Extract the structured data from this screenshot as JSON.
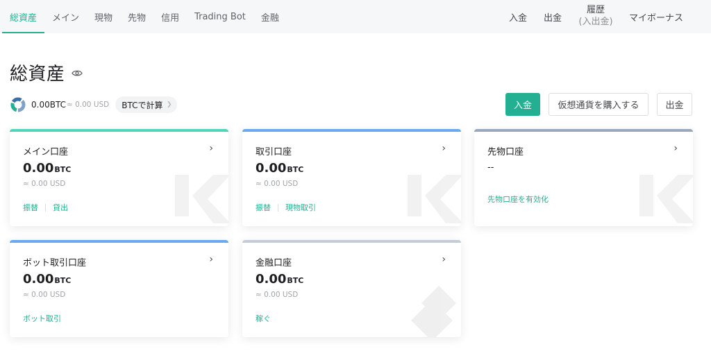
{
  "nav": {
    "left_items": [
      {
        "label": "総資産",
        "active": true
      },
      {
        "label": "メイン"
      },
      {
        "label": "現物"
      },
      {
        "label": "先物"
      },
      {
        "label": "信用"
      },
      {
        "label": "Trading Bot"
      },
      {
        "label": "金融"
      }
    ],
    "deposit": "入金",
    "withdraw": "出金",
    "history": "履歴",
    "history_sub": "(入出金)",
    "bonus": "マイボーナス"
  },
  "header": {
    "title": "総資産",
    "total_btc": "0.00BTC",
    "total_usd": "≈ 0.00 USD",
    "calc_label": "BTCで計算"
  },
  "actions": {
    "deposit": "入金",
    "buy_crypto": "仮想通貨を購入する",
    "withdraw": "出金"
  },
  "cards": [
    {
      "title": "メイン口座",
      "balance": "0.00",
      "unit": "BTC",
      "usd": "≈ 0.00 USD",
      "links": [
        "振替",
        "貸出"
      ],
      "color": "#52d4b8"
    },
    {
      "title": "取引口座",
      "balance": "0.00",
      "unit": "BTC",
      "usd": "≈ 0.00 USD",
      "links": [
        "振替",
        "現物取引"
      ],
      "color": "#6aa9ee"
    },
    {
      "title": "先物口座",
      "balance": "--",
      "link": "先物口座を有効化",
      "color": "#9aa7bd"
    },
    {
      "title": "ボット取引口座",
      "balance": "0.00",
      "unit": "BTC",
      "usd": "≈ 0.00 USD",
      "links": [
        "ボット取引"
      ],
      "color": "#6aa9ee"
    },
    {
      "title": "金融口座",
      "balance": "0.00",
      "unit": "BTC",
      "usd": "≈ 0.00 USD",
      "links": [
        "稼ぐ"
      ],
      "color": "#c4ccd7"
    }
  ],
  "colors": {
    "accent": "#23af91"
  },
  "icons": {
    "eye": "eye-icon",
    "ring": "asset-ring-icon",
    "arrow": "chevron-right-icon"
  }
}
